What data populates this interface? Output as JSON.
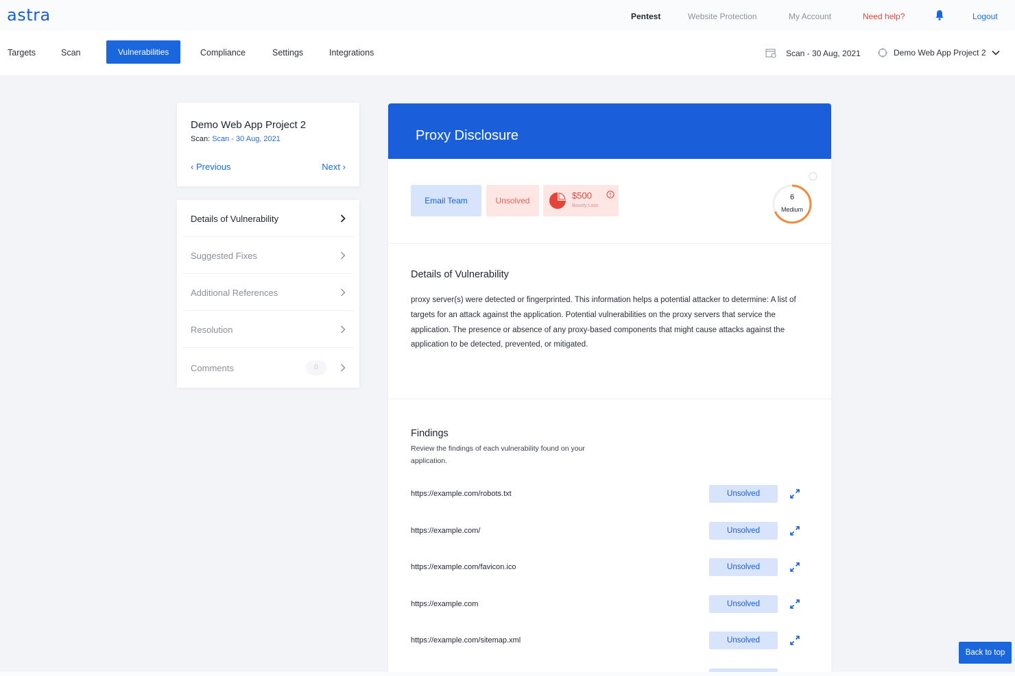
{
  "app": {
    "logo": "astra"
  },
  "topnav": {
    "pentest": "Pentest",
    "website_protection": "Website Protection",
    "my_account": "My Account",
    "need_help": "Need help?",
    "logout": "Logout"
  },
  "nav": {
    "targets": "Targets",
    "scan": "Scan",
    "vulnerabilities": "Vulnerabilities",
    "compliance": "Compliance",
    "settings": "Settings",
    "integrations": "Integrations",
    "scan_selector": "Scan - 30 Aug, 2021",
    "project_selector": "Demo Web App Project 2"
  },
  "project_card": {
    "title": "Demo Web App Project 2",
    "scan_label": "Scan:",
    "scan_value": "Scan - 30 Aug, 2021",
    "previous": "Previous",
    "next": "Next"
  },
  "side_menu": {
    "items": [
      {
        "label": "Details of Vulnerability"
      },
      {
        "label": "Suggested Fixes"
      },
      {
        "label": "Additional References"
      },
      {
        "label": "Resolution"
      },
      {
        "label": "Comments",
        "count": "0"
      }
    ]
  },
  "vulnerability": {
    "title": "Proxy Disclosure",
    "email_team": "Email Team",
    "status": "Unsolved",
    "bounty_amount": "$500",
    "bounty_label": "Bounty Loss",
    "severity_score": "6",
    "severity_label": "Medium",
    "colors": {
      "header": "#1a5fd9",
      "danger": "#e5443b",
      "severity_ring": "#f08a3c"
    }
  },
  "details": {
    "title": "Details of Vulnerability",
    "text": "proxy server(s) were detected or fingerprinted. This information helps a potential attacker to determine: A list of targets for an attack against the application. Potential vulnerabilities on the proxy servers that service the application. The presence or absence of any proxy-based components that might cause attacks against the application to be detected, prevented, or mitigated."
  },
  "findings": {
    "title": "Findings",
    "subtitle": "Review the findings of each vulnerability found on your application.",
    "rows": [
      {
        "url": "https://example.com/robots.txt",
        "status": "Unsolved"
      },
      {
        "url": "https://example.com/",
        "status": "Unsolved"
      },
      {
        "url": "https://example.com/favicon.ico",
        "status": "Unsolved"
      },
      {
        "url": "https://example.com",
        "status": "Unsolved"
      },
      {
        "url": "https://example.com/sitemap.xml",
        "status": "Unsolved"
      }
    ]
  },
  "back_to_top": "Back to top"
}
